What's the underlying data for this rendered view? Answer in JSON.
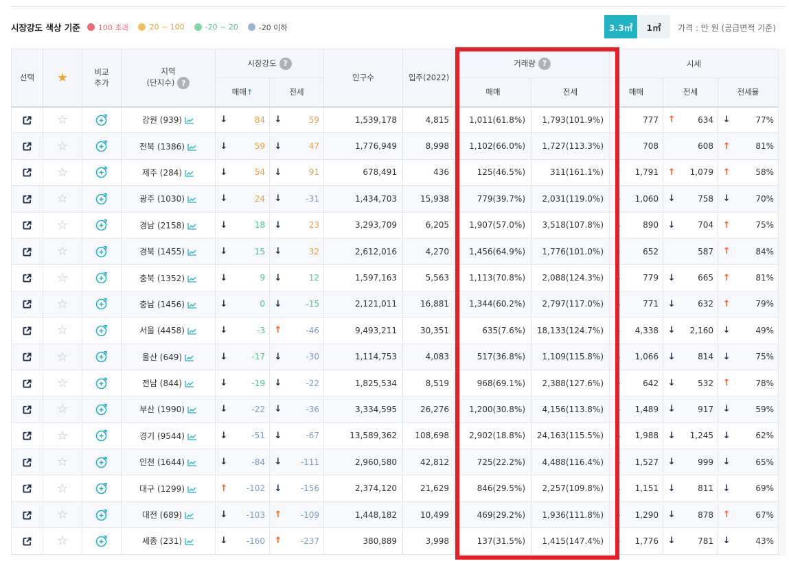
{
  "legend": {
    "title": "시장강도 색상 기준",
    "items": [
      {
        "label": "100 초과",
        "color": "#f06a7a",
        "text_color": "#f06a7a"
      },
      {
        "label": "20 ~ 100",
        "color": "#f0c060",
        "text_color": "#e6a33c"
      },
      {
        "label": "-20 ~ 20",
        "color": "#7fd6a7",
        "text_color": "#4cc48b"
      },
      {
        "label": "-20 이하",
        "color": "#9ab3d6",
        "text_color": "#444444"
      }
    ]
  },
  "unit_toggle": {
    "active_label": "3.3㎡",
    "inactive_label": "1㎡"
  },
  "unit_caption": "가격 : 만 원 (공급면적 기준)",
  "colors": {
    "accent": "#1fb3c4",
    "up": "#f26522",
    "down": "#1f2d4a",
    "highlight": "#ee1d24",
    "star": "#f5a623"
  },
  "headers": {
    "select": "선택",
    "compare_1": "비교",
    "compare_2": "추가",
    "region_1": "지역",
    "region_2": "(단지수)",
    "market_strength": "시장강도",
    "population": "인구수",
    "move_in": "입주(2022)",
    "volume": "거래량",
    "price": "시세",
    "sale": "매매",
    "lease": "전세",
    "sale_sorted": "매매",
    "lease_ratio": "전세율"
  },
  "rows": [
    {
      "region": "강원 (939)",
      "ms_sale": {
        "arrow": "down",
        "value": "84",
        "color": "orange"
      },
      "ms_lease": {
        "arrow": "down",
        "value": "59",
        "color": "orange"
      },
      "population": "1,539,178",
      "move_in": "4,815",
      "vol_sale": "1,011(61.8%)",
      "vol_lease": "1,793(101.9%)",
      "price_sale": {
        "arrow": "up",
        "value": "777"
      },
      "price_lease": {
        "arrow": "up",
        "value": "634"
      },
      "ratio": {
        "arrow": "down",
        "value": "77%"
      }
    },
    {
      "region": "전북 (1386)",
      "ms_sale": {
        "arrow": "down",
        "value": "59",
        "color": "orange"
      },
      "ms_lease": {
        "arrow": "down",
        "value": "47",
        "color": "orange"
      },
      "population": "1,776,949",
      "move_in": "8,998",
      "vol_sale": "1,102(66.0%)",
      "vol_lease": "1,727(113.3%)",
      "price_sale": {
        "arrow": "",
        "value": "708"
      },
      "price_lease": {
        "arrow": "",
        "value": "608"
      },
      "ratio": {
        "arrow": "up",
        "value": "81%"
      }
    },
    {
      "region": "제주 (284)",
      "ms_sale": {
        "arrow": "down",
        "value": "54",
        "color": "orange"
      },
      "ms_lease": {
        "arrow": "down",
        "value": "91",
        "color": "orange"
      },
      "population": "678,491",
      "move_in": "436",
      "vol_sale": "125(46.5%)",
      "vol_lease": "311(161.1%)",
      "price_sale": {
        "arrow": "up",
        "value": "1,791"
      },
      "price_lease": {
        "arrow": "up",
        "value": "1,079"
      },
      "ratio": {
        "arrow": "up",
        "value": "58%"
      }
    },
    {
      "region": "광주 (1030)",
      "ms_sale": {
        "arrow": "down",
        "value": "24",
        "color": "orange"
      },
      "ms_lease": {
        "arrow": "down",
        "value": "-31",
        "color": "blue"
      },
      "population": "1,434,703",
      "move_in": "15,938",
      "vol_sale": "779(39.7%)",
      "vol_lease": "2,031(119.0%)",
      "price_sale": {
        "arrow": "down",
        "value": "1,060"
      },
      "price_lease": {
        "arrow": "down",
        "value": "758"
      },
      "ratio": {
        "arrow": "down",
        "value": "70%"
      }
    },
    {
      "region": "경남 (2158)",
      "ms_sale": {
        "arrow": "down",
        "value": "18",
        "color": "green"
      },
      "ms_lease": {
        "arrow": "down",
        "value": "23",
        "color": "orange"
      },
      "population": "3,293,709",
      "move_in": "6,205",
      "vol_sale": "1,907(57.0%)",
      "vol_lease": "3,518(107.8%)",
      "price_sale": {
        "arrow": "down",
        "value": "890"
      },
      "price_lease": {
        "arrow": "down",
        "value": "704"
      },
      "ratio": {
        "arrow": "up",
        "value": "75%"
      }
    },
    {
      "region": "경북 (1455)",
      "ms_sale": {
        "arrow": "down",
        "value": "15",
        "color": "green"
      },
      "ms_lease": {
        "arrow": "down",
        "value": "32",
        "color": "orange"
      },
      "population": "2,612,016",
      "move_in": "4,270",
      "vol_sale": "1,456(64.9%)",
      "vol_lease": "1,776(101.0%)",
      "price_sale": {
        "arrow": "down",
        "value": "652"
      },
      "price_lease": {
        "arrow": "",
        "value": "587"
      },
      "ratio": {
        "arrow": "up",
        "value": "84%"
      }
    },
    {
      "region": "충북 (1352)",
      "ms_sale": {
        "arrow": "down",
        "value": "9",
        "color": "green"
      },
      "ms_lease": {
        "arrow": "down",
        "value": "12",
        "color": "green"
      },
      "population": "1,597,163",
      "move_in": "5,563",
      "vol_sale": "1,113(70.8%)",
      "vol_lease": "2,088(124.3%)",
      "price_sale": {
        "arrow": "down",
        "value": "779"
      },
      "price_lease": {
        "arrow": "down",
        "value": "665"
      },
      "ratio": {
        "arrow": "up",
        "value": "81%"
      }
    },
    {
      "region": "충남 (1456)",
      "ms_sale": {
        "arrow": "down",
        "value": "0",
        "color": "green"
      },
      "ms_lease": {
        "arrow": "down",
        "value": "-15",
        "color": "green"
      },
      "population": "2,121,011",
      "move_in": "16,881",
      "vol_sale": "1,344(60.2%)",
      "vol_lease": "2,797(117.0%)",
      "price_sale": {
        "arrow": "down",
        "value": "771"
      },
      "price_lease": {
        "arrow": "down",
        "value": "632"
      },
      "ratio": {
        "arrow": "up",
        "value": "79%"
      }
    },
    {
      "region": "서울 (4458)",
      "ms_sale": {
        "arrow": "down",
        "value": "-3",
        "color": "green"
      },
      "ms_lease": {
        "arrow": "up",
        "value": "-46",
        "color": "blue"
      },
      "population": "9,493,211",
      "move_in": "30,351",
      "vol_sale": "635(7.6%)",
      "vol_lease": "18,133(124.7%)",
      "price_sale": {
        "arrow": "down",
        "value": "4,338"
      },
      "price_lease": {
        "arrow": "down",
        "value": "2,160"
      },
      "ratio": {
        "arrow": "down",
        "value": "49%"
      }
    },
    {
      "region": "울산 (649)",
      "ms_sale": {
        "arrow": "down",
        "value": "-17",
        "color": "green"
      },
      "ms_lease": {
        "arrow": "down",
        "value": "-30",
        "color": "blue"
      },
      "population": "1,114,753",
      "move_in": "4,083",
      "vol_sale": "517(36.8%)",
      "vol_lease": "1,109(115.8%)",
      "price_sale": {
        "arrow": "down",
        "value": "1,066"
      },
      "price_lease": {
        "arrow": "down",
        "value": "814"
      },
      "ratio": {
        "arrow": "down",
        "value": "75%"
      }
    },
    {
      "region": "전남 (844)",
      "ms_sale": {
        "arrow": "down",
        "value": "-19",
        "color": "green"
      },
      "ms_lease": {
        "arrow": "down",
        "value": "-22",
        "color": "blue"
      },
      "population": "1,825,534",
      "move_in": "8,519",
      "vol_sale": "968(69.1%)",
      "vol_lease": "2,388(127.6%)",
      "price_sale": {
        "arrow": "down",
        "value": "642"
      },
      "price_lease": {
        "arrow": "down",
        "value": "532"
      },
      "ratio": {
        "arrow": "up",
        "value": "78%"
      }
    },
    {
      "region": "부산 (1990)",
      "ms_sale": {
        "arrow": "down",
        "value": "-22",
        "color": "blue"
      },
      "ms_lease": {
        "arrow": "down",
        "value": "-36",
        "color": "blue"
      },
      "population": "3,334,595",
      "move_in": "26,276",
      "vol_sale": "1,200(30.8%)",
      "vol_lease": "4,156(113.8%)",
      "price_sale": {
        "arrow": "down",
        "value": "1,489"
      },
      "price_lease": {
        "arrow": "down",
        "value": "917"
      },
      "ratio": {
        "arrow": "down",
        "value": "59%"
      }
    },
    {
      "region": "경기 (9544)",
      "ms_sale": {
        "arrow": "down",
        "value": "-51",
        "color": "blue"
      },
      "ms_lease": {
        "arrow": "down",
        "value": "-67",
        "color": "blue"
      },
      "population": "13,589,362",
      "move_in": "108,698",
      "vol_sale": "2,902(18.8%)",
      "vol_lease": "24,163(115.5%)",
      "price_sale": {
        "arrow": "down",
        "value": "1,988"
      },
      "price_lease": {
        "arrow": "down",
        "value": "1,245"
      },
      "ratio": {
        "arrow": "down",
        "value": "62%"
      }
    },
    {
      "region": "인천 (1644)",
      "ms_sale": {
        "arrow": "down",
        "value": "-84",
        "color": "blue"
      },
      "ms_lease": {
        "arrow": "down",
        "value": "-111",
        "color": "blue"
      },
      "population": "2,960,580",
      "move_in": "42,812",
      "vol_sale": "725(22.2%)",
      "vol_lease": "4,488(116.4%)",
      "price_sale": {
        "arrow": "down",
        "value": "1,527"
      },
      "price_lease": {
        "arrow": "down",
        "value": "999"
      },
      "ratio": {
        "arrow": "down",
        "value": "65%"
      }
    },
    {
      "region": "대구 (1299)",
      "ms_sale": {
        "arrow": "up",
        "value": "-102",
        "color": "blue"
      },
      "ms_lease": {
        "arrow": "down",
        "value": "-156",
        "color": "blue"
      },
      "population": "2,374,120",
      "move_in": "21,629",
      "vol_sale": "846(29.5%)",
      "vol_lease": "2,257(109.8%)",
      "price_sale": {
        "arrow": "down",
        "value": "1,151"
      },
      "price_lease": {
        "arrow": "down",
        "value": "811"
      },
      "ratio": {
        "arrow": "down",
        "value": "69%"
      }
    },
    {
      "region": "대전 (689)",
      "ms_sale": {
        "arrow": "down",
        "value": "-103",
        "color": "blue"
      },
      "ms_lease": {
        "arrow": "up",
        "value": "-109",
        "color": "blue"
      },
      "population": "1,448,182",
      "move_in": "10,499",
      "vol_sale": "469(29.2%)",
      "vol_lease": "1,936(111.8%)",
      "price_sale": {
        "arrow": "down",
        "value": "1,290"
      },
      "price_lease": {
        "arrow": "down",
        "value": "878"
      },
      "ratio": {
        "arrow": "up",
        "value": "67%"
      }
    },
    {
      "region": "세종 (231)",
      "ms_sale": {
        "arrow": "down",
        "value": "-160",
        "color": "blue"
      },
      "ms_lease": {
        "arrow": "up",
        "value": "-237",
        "color": "blue"
      },
      "population": "380,889",
      "move_in": "3,998",
      "vol_sale": "137(31.5%)",
      "vol_lease": "1,415(147.4%)",
      "price_sale": {
        "arrow": "down",
        "value": "1,776"
      },
      "price_lease": {
        "arrow": "down",
        "value": "781"
      },
      "ratio": {
        "arrow": "down",
        "value": "43%"
      }
    }
  ]
}
